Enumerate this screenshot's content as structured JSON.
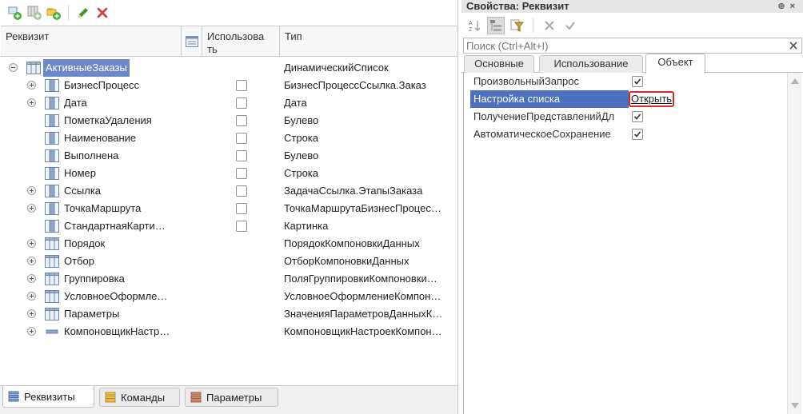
{
  "left_panel": {
    "columns": {
      "name": "Реквизит",
      "usage": "Использова ть",
      "type": "Тип"
    },
    "rows": [
      {
        "name": "АктивныеЗаказы",
        "type": "ДинамическийСписок",
        "expandable": true,
        "expanded": true,
        "selected": true,
        "level": 0,
        "checkbox": false,
        "icon": "table-icon"
      },
      {
        "name": "БизнесПроцесс",
        "type": "БизнесПроцессСсылка.Заказ",
        "expandable": true,
        "level": 1,
        "checkbox": true,
        "checked": false,
        "icon": "column-icon"
      },
      {
        "name": "Дата",
        "type": "Дата",
        "expandable": true,
        "level": 1,
        "checkbox": true,
        "checked": false,
        "icon": "column-icon"
      },
      {
        "name": "ПометкаУдаления",
        "type": "Булево",
        "expandable": false,
        "level": 1,
        "checkbox": true,
        "checked": false,
        "icon": "column-icon"
      },
      {
        "name": "Наименование",
        "type": "Строка",
        "expandable": false,
        "level": 1,
        "checkbox": true,
        "checked": false,
        "icon": "column-icon"
      },
      {
        "name": "Выполнена",
        "type": "Булево",
        "expandable": false,
        "level": 1,
        "checkbox": true,
        "checked": false,
        "icon": "column-icon"
      },
      {
        "name": "Номер",
        "type": "Строка",
        "expandable": false,
        "level": 1,
        "checkbox": true,
        "checked": false,
        "icon": "column-icon"
      },
      {
        "name": "Ссылка",
        "type": "ЗадачаСсылка.ЭтапыЗаказа",
        "expandable": true,
        "level": 1,
        "checkbox": true,
        "checked": false,
        "icon": "column-icon"
      },
      {
        "name": "ТочкаМаршрута",
        "type": "ТочкаМаршрутаБизнесПроцес…",
        "expandable": true,
        "level": 1,
        "checkbox": true,
        "checked": false,
        "icon": "column-icon"
      },
      {
        "name": "СтандартнаяКарти…",
        "type": "Картинка",
        "expandable": false,
        "level": 1,
        "checkbox": true,
        "checked": false,
        "icon": "column-icon"
      },
      {
        "name": "Порядок",
        "type": "ПорядокКомпоновкиДанных",
        "expandable": true,
        "level": 1,
        "checkbox": false,
        "icon": "table-icon"
      },
      {
        "name": "Отбор",
        "type": "ОтборКомпоновкиДанных",
        "expandable": true,
        "level": 1,
        "checkbox": false,
        "icon": "table-icon"
      },
      {
        "name": "Группировка",
        "type": "ПоляГруппировкиКомпоновки…",
        "expandable": true,
        "level": 1,
        "checkbox": false,
        "icon": "table-icon"
      },
      {
        "name": "УсловноеОформле…",
        "type": "УсловноеОформлениеКомпон…",
        "expandable": true,
        "level": 1,
        "checkbox": false,
        "icon": "table-icon"
      },
      {
        "name": "Параметры",
        "type": "ЗначенияПараметровДанныхК…",
        "expandable": true,
        "level": 1,
        "checkbox": false,
        "icon": "table-icon"
      },
      {
        "name": "КомпоновщикНастр…",
        "type": "КомпоновщикНастроекКомпон…",
        "expandable": true,
        "level": 1,
        "checkbox": false,
        "icon": "minus-bar-icon"
      }
    ],
    "bottom_tabs": [
      {
        "label": "Реквизиты",
        "active": true
      },
      {
        "label": "Команды",
        "active": false
      },
      {
        "label": "Параметры",
        "active": false
      }
    ]
  },
  "right_panel": {
    "title": "Свойства: Реквизит",
    "search_placeholder": "Поиск (Ctrl+Alt+I)",
    "tabs": [
      {
        "label": "Основные",
        "active": false
      },
      {
        "label": "Использование",
        "active": false
      },
      {
        "label": "Объект",
        "active": true
      }
    ],
    "properties": [
      {
        "name": "ПроизвольныйЗапрос",
        "kind": "checkbox",
        "checked": true
      },
      {
        "name": "Настройка списка",
        "kind": "link",
        "value": "Открыть",
        "selected": true
      },
      {
        "name": "ПолучениеПредставленийДл",
        "kind": "checkbox",
        "checked": true
      },
      {
        "name": "АвтоматическоеСохранение",
        "kind": "checkbox",
        "checked": true
      }
    ]
  },
  "colors": {
    "selection_left": "#6d87c9",
    "selection_right": "#4c6fbf",
    "link_highlight": "#d42a2a",
    "delete_red": "#d63a2a",
    "edit_green": "#3e9a2c"
  }
}
